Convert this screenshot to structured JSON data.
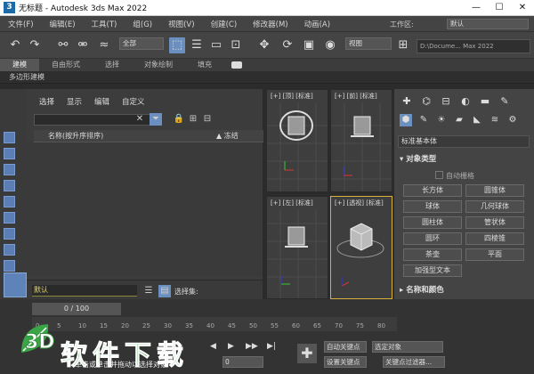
{
  "window": {
    "app_icon": "3",
    "title": "无标题 - Autodesk 3ds Max 2022",
    "minimize": "—",
    "maximize": "☐",
    "close": "✕"
  },
  "menubar": {
    "items": [
      "文件(F)",
      "编辑(E)",
      "工具(T)",
      "组(G)",
      "视图(V)",
      "创建(C)",
      "修改器(M)",
      "动画(A)"
    ],
    "workspace_label": "工作区:",
    "workspace_value": "默认"
  },
  "toolbar": {
    "selection_filter": "全部",
    "ref_coord": "视图",
    "path": "D:\\Docume... Max 2022"
  },
  "ribbon": {
    "tabs": [
      "建模",
      "自由形式",
      "选择",
      "对象绘制",
      "填充"
    ],
    "active": "建模",
    "sub_label": "多边形建模"
  },
  "scene_explorer": {
    "menu": [
      "选择",
      "显示",
      "编辑",
      "自定义"
    ],
    "col_name": "名称(按升序排序)",
    "col_frozen": "▲ 冻结",
    "layer_value": "默认",
    "layer_label": "选择集:"
  },
  "viewports": [
    {
      "label": "[+] [顶] [标准]"
    },
    {
      "label": "[+] [前] [标准]"
    },
    {
      "label": "[+] [左] [标准]"
    },
    {
      "label": "[+] [透视] [标准]"
    }
  ],
  "command_panel": {
    "primitive_type": "标准基本体",
    "rollout_object_type": "对象类型",
    "autogrid": "自动栅格",
    "buttons": [
      "长方体",
      "圆锥体",
      "球体",
      "几何球体",
      "圆柱体",
      "管状体",
      "圆环",
      "四棱锥",
      "茶壶",
      "平面",
      "加强型文本"
    ],
    "rollout_name_color": "名称和颜色"
  },
  "timeline": {
    "frame": "0 / 100",
    "ticks": [
      "0",
      "5",
      "10",
      "15",
      "20",
      "25",
      "30",
      "35",
      "40",
      "45",
      "50",
      "55",
      "60",
      "65",
      "70",
      "75",
      "80"
    ],
    "frame_input": "0",
    "auto_key": "自动关键点",
    "set_key": "设置关键点",
    "selected_obj": "选定对象",
    "key_filters": "关键点过滤器..."
  },
  "status": {
    "hint": "单击或单击并拖动以选择对象"
  },
  "watermark": {
    "text": "软件下载",
    "logo": "3D"
  },
  "colors": {
    "accent_blue": "#6b8fbf",
    "active_viewport": "#d6b23c",
    "watermark_green": "#3aa547"
  }
}
